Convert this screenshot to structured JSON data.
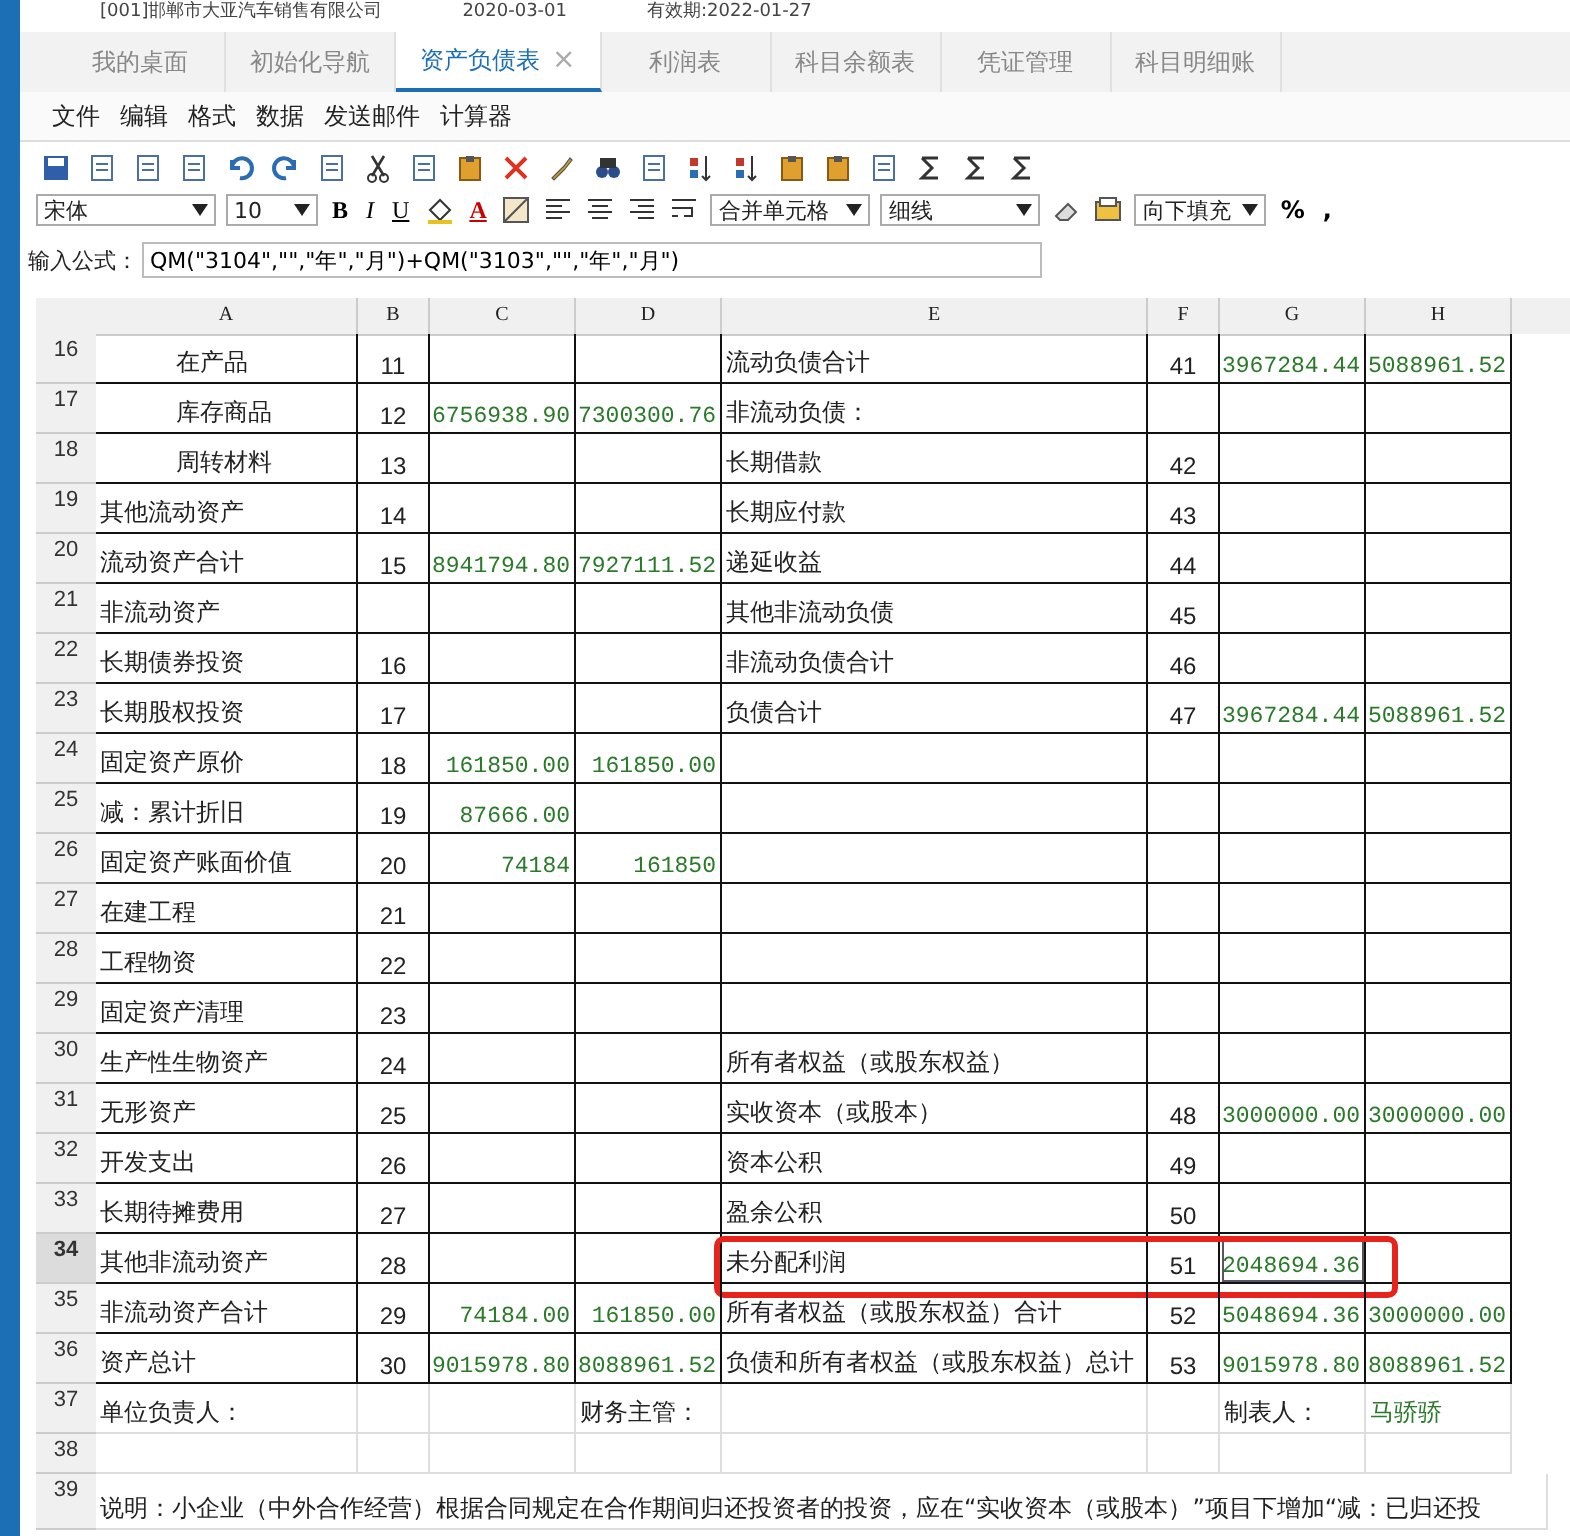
{
  "header": {
    "company": "[001]邯郸市大亚汽车销售有限公司",
    "date": "2020-03-01",
    "validity": "有效期:2022-01-27"
  },
  "tabs": [
    {
      "label": "我的桌面",
      "selected": false
    },
    {
      "label": "初始化导航",
      "selected": false
    },
    {
      "label": "资产负债表",
      "selected": true,
      "close": "×"
    },
    {
      "label": "利润表",
      "selected": false
    },
    {
      "label": "科目余额表",
      "selected": false
    },
    {
      "label": "凭证管理",
      "selected": false
    },
    {
      "label": "科目明细账",
      "selected": false
    }
  ],
  "menu": [
    "文件",
    "编辑",
    "格式",
    "数据",
    "发送邮件",
    "计算器"
  ],
  "format_bar": {
    "font": "宋体",
    "size": "10",
    "style_buttons": [
      "B",
      "I",
      "U"
    ],
    "font_color": "A",
    "merge": "合并单元格",
    "border": "细线",
    "fill": "向下填充",
    "percent": "%",
    "comma": ","
  },
  "formula": {
    "label": "输入公式：",
    "value": "QM(\"3104\",\"\",\"年\",\"月\")+QM(\"3103\",\"\",\"年\",\"月\")"
  },
  "columns": [
    "A",
    "B",
    "C",
    "D",
    "E",
    "F",
    "G",
    "H"
  ],
  "rows": [
    {
      "num": "16",
      "kind": "data",
      "selected": false,
      "indent": true,
      "a": "在产品",
      "b": "11",
      "e": "流动负债合计",
      "f": "41",
      "g": "3967284.44",
      "h": "5088961.52"
    },
    {
      "num": "17",
      "kind": "data",
      "selected": false,
      "indent": true,
      "a": "库存商品",
      "b": "12",
      "c": "6756938.90",
      "d": "7300300.76",
      "e": "非流动负债："
    },
    {
      "num": "18",
      "kind": "data",
      "selected": false,
      "indent": true,
      "a": "周转材料",
      "b": "13",
      "e": "长期借款",
      "f": "42"
    },
    {
      "num": "19",
      "kind": "data",
      "selected": false,
      "indent": false,
      "a": "其他流动资产",
      "b": "14",
      "e": "长期应付款",
      "f": "43"
    },
    {
      "num": "20",
      "kind": "data",
      "selected": false,
      "indent": false,
      "a": "流动资产合计",
      "b": "15",
      "c": "8941794.80",
      "d": "7927111.52",
      "e": "递延收益",
      "f": "44"
    },
    {
      "num": "21",
      "kind": "data",
      "selected": false,
      "indent": false,
      "a": "非流动资产",
      "e": "其他非流动负债",
      "f": "45"
    },
    {
      "num": "22",
      "kind": "data",
      "selected": false,
      "indent": false,
      "a": "长期债券投资",
      "b": "16",
      "e": "非流动负债合计",
      "f": "46"
    },
    {
      "num": "23",
      "kind": "data",
      "selected": false,
      "indent": false,
      "a": "长期股权投资",
      "b": "17",
      "e": "负债合计",
      "f": "47",
      "g": "3967284.44",
      "h": "5088961.52"
    },
    {
      "num": "24",
      "kind": "data",
      "selected": false,
      "indent": false,
      "a": "固定资产原价",
      "b": "18",
      "c": "161850.00",
      "d": "161850.00"
    },
    {
      "num": "25",
      "kind": "data",
      "selected": false,
      "indent": false,
      "a": "减：累计折旧",
      "b": "19",
      "c": "87666.00"
    },
    {
      "num": "26",
      "kind": "data",
      "selected": false,
      "indent": false,
      "a": "固定资产账面价值",
      "b": "20",
      "c": "74184",
      "d": "161850"
    },
    {
      "num": "27",
      "kind": "data",
      "selected": false,
      "indent": false,
      "a": "在建工程",
      "b": "21"
    },
    {
      "num": "28",
      "kind": "data",
      "selected": false,
      "indent": false,
      "a": "工程物资",
      "b": "22"
    },
    {
      "num": "29",
      "kind": "data",
      "selected": false,
      "indent": false,
      "a": "固定资产清理",
      "b": "23"
    },
    {
      "num": "30",
      "kind": "data",
      "selected": false,
      "indent": false,
      "a": "生产性生物资产",
      "b": "24",
      "e": "所有者权益（或股东权益）"
    },
    {
      "num": "31",
      "kind": "data",
      "selected": false,
      "indent": false,
      "a": "无形资产",
      "b": "25",
      "e": "实收资本（或股本）",
      "f": "48",
      "g": "3000000.00",
      "h": "3000000.00"
    },
    {
      "num": "32",
      "kind": "data",
      "selected": false,
      "indent": false,
      "a": "开发支出",
      "b": "26",
      "e": "资本公积",
      "f": "49"
    },
    {
      "num": "33",
      "kind": "data",
      "selected": false,
      "indent": false,
      "a": "长期待摊费用",
      "b": "27",
      "e": "盈余公积",
      "f": "50"
    },
    {
      "num": "34",
      "kind": "data",
      "selected": true,
      "indent": false,
      "annotated": true,
      "a": "其他非流动资产",
      "b": "28",
      "e": "未分配利润",
      "f": "51",
      "g": "2048694.36"
    },
    {
      "num": "35",
      "kind": "data",
      "selected": false,
      "indent": false,
      "a": "非流动资产合计",
      "b": "29",
      "c": "74184.00",
      "d": "161850.00",
      "e": "所有者权益（或股东权益）合计",
      "f": "52",
      "g": "5048694.36",
      "h": "3000000.00"
    },
    {
      "num": "36",
      "kind": "data",
      "selected": false,
      "indent": false,
      "a": "资产总计",
      "b": "30",
      "c": "9015978.80",
      "d": "8088961.52",
      "e": "负债和所有者权益（或股东权益）总计",
      "f": "53",
      "g": "9015978.80",
      "h": "8088961.52"
    },
    {
      "num": "37",
      "kind": "signature",
      "selected": false,
      "a": "单位负责人：",
      "d": "财务主管：",
      "g": "制表人：",
      "h": "马骄骄"
    },
    {
      "num": "38",
      "kind": "blank",
      "selected": false
    },
    {
      "num": "39",
      "kind": "note",
      "selected": false,
      "a": "说明：小企业（中外合作经营）根据合同规定在合作期间归还投资者的投资，应在“实收资本（或股本）”项目下增加“减：已归还投"
    }
  ]
}
